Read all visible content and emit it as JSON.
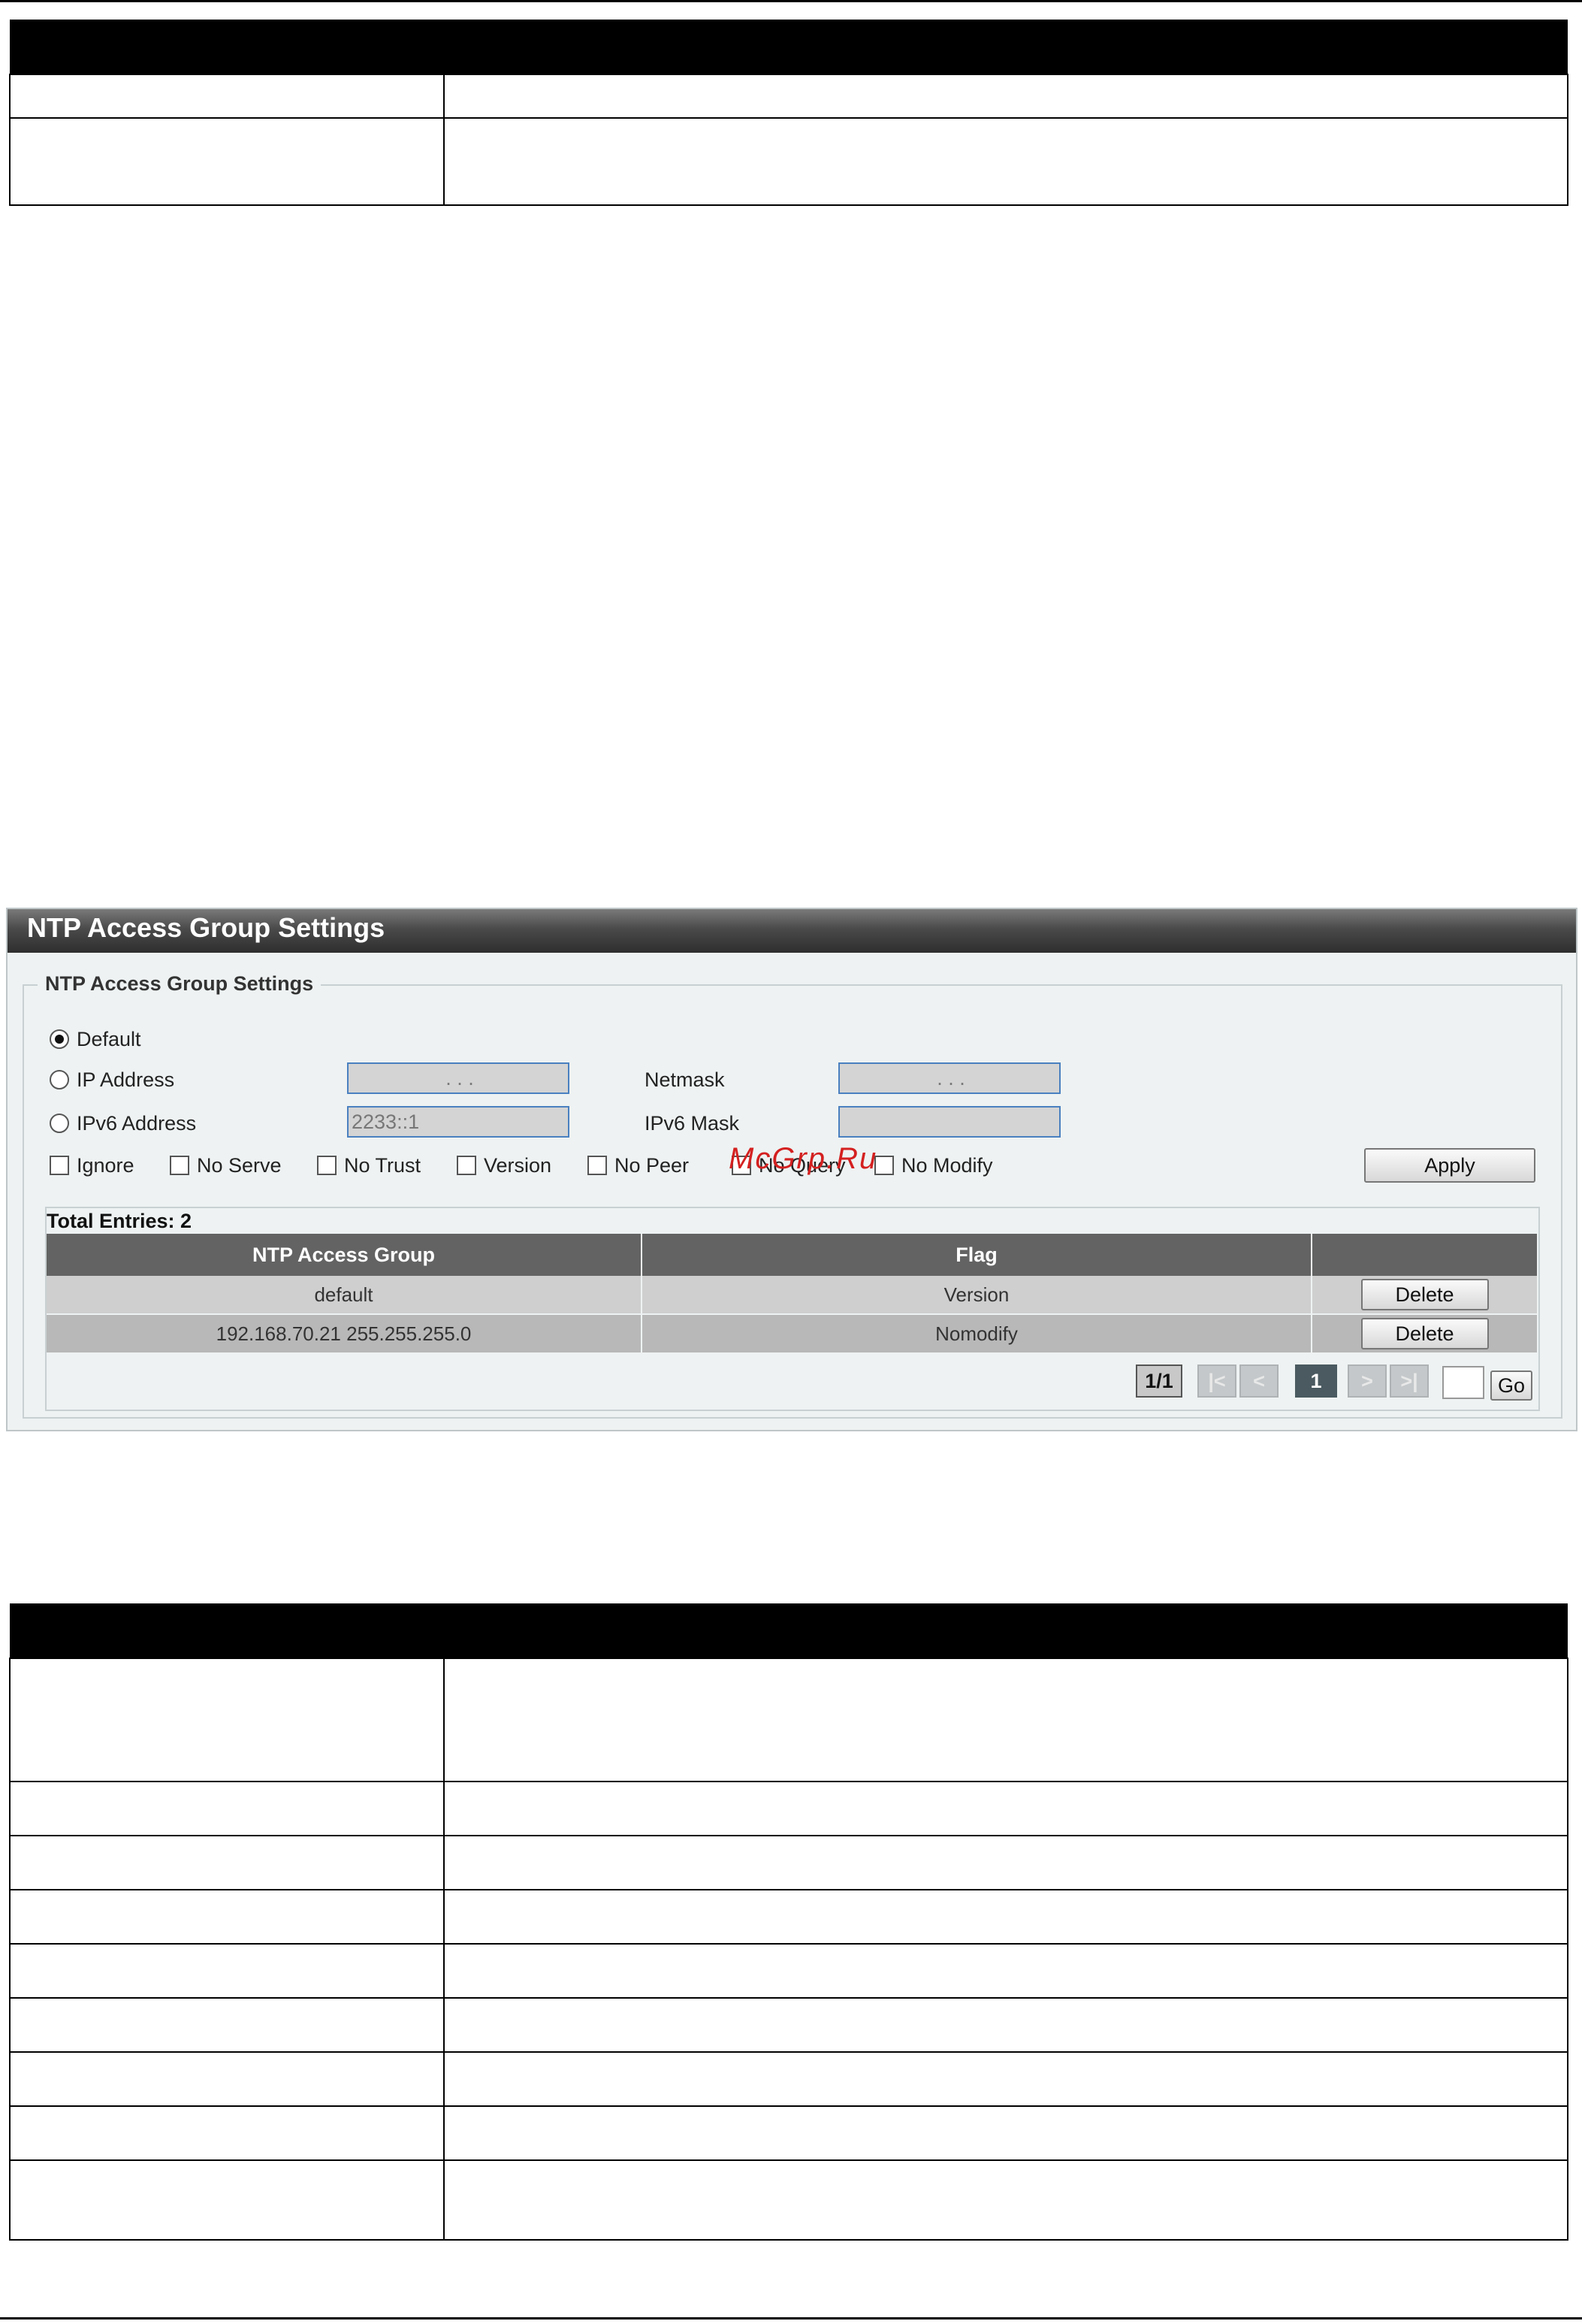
{
  "panel": {
    "title": "NTP Access Group Settings",
    "legend": "NTP Access Group Settings",
    "watermark": "McGrp.Ru"
  },
  "form": {
    "radios": [
      {
        "label": "Default",
        "selected": true
      },
      {
        "label": "IP Address",
        "selected": false
      },
      {
        "label": "IPv6 Address",
        "selected": false
      }
    ],
    "ip_address_value": ".      .      .",
    "netmask_label": "Netmask",
    "netmask_value": ".      .      .",
    "ipv6_address_value": "2233::1",
    "ipv6_mask_label": "IPv6 Mask",
    "ipv6_mask_value": "",
    "checkboxes": [
      "Ignore",
      "No Serve",
      "No Trust",
      "Version",
      "No Peer",
      "No Query",
      "No Modify"
    ],
    "apply_label": "Apply"
  },
  "table": {
    "total_entries": "Total Entries: 2",
    "headers": [
      "NTP Access Group",
      "Flag",
      ""
    ],
    "rows": [
      {
        "group": "default",
        "flag": "Version",
        "action": "Delete"
      },
      {
        "group": "192.168.70.21 255.255.255.0",
        "flag": "Nomodify",
        "action": "Delete"
      }
    ]
  },
  "pagination": {
    "count": "1/1",
    "first": "|<",
    "prev": "<",
    "current": "1",
    "next": ">",
    "last": ">|",
    "go_label": "Go"
  }
}
